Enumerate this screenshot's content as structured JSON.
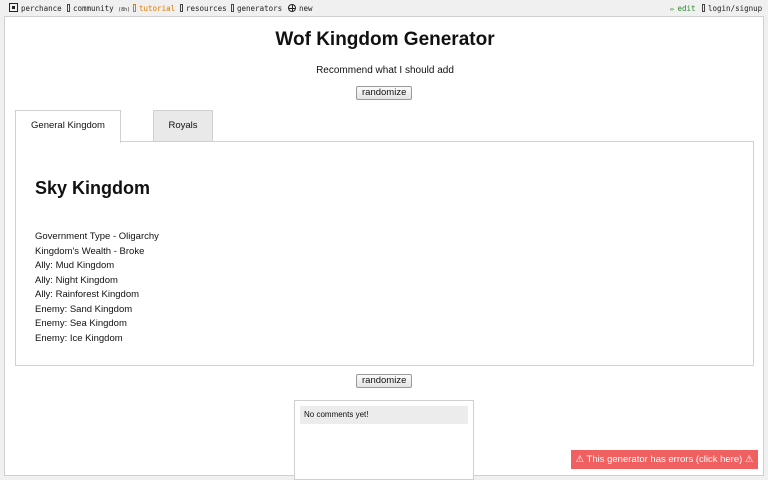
{
  "topbar": {
    "left": [
      {
        "key": "perchance",
        "label": "perchance",
        "icon": "perchance-logo-icon"
      },
      {
        "key": "community",
        "label": "community",
        "badge": "(8h)",
        "icon": "chat-icon"
      },
      {
        "key": "tutorial",
        "label": "tutorial",
        "icon": "book-icon"
      },
      {
        "key": "resources",
        "label": "resources",
        "icon": "resources-icon"
      },
      {
        "key": "generators",
        "label": "generators",
        "icon": "generators-icon"
      },
      {
        "key": "new",
        "label": "new",
        "icon": "plus-circle-icon"
      }
    ],
    "right": [
      {
        "key": "edit",
        "label": "edit",
        "icon": "pencil-icon"
      },
      {
        "key": "login",
        "label": "login/signup",
        "icon": "user-icon"
      }
    ]
  },
  "generator": {
    "title": "Wof Kingdom Generator",
    "subtitle": "Recommend what I should add",
    "randomize_label": "randomize"
  },
  "tabs": [
    {
      "label": "General Kingdom",
      "active": true
    },
    {
      "label": "Royals",
      "active": false
    }
  ],
  "result": {
    "kingdom_name": "Sky Kingdom",
    "lines": [
      "Government Type - Oligarchy",
      "Kingdom's Wealth - Broke",
      "Ally: Mud Kingdom",
      "Ally: Night Kingdom",
      "Ally: Rainforest Kingdom",
      "Enemy: Sand Kingdom",
      "Enemy: Sea Kingdom",
      "Enemy: Ice Kingdom"
    ]
  },
  "comments": {
    "empty_text": "No comments yet!"
  },
  "error_banner": {
    "text": "⚠ This generator has errors (click here) ⚠"
  },
  "colors": {
    "tutorial": "#e07b00",
    "edit": "#2a8a2a",
    "error_bg": "#f06060"
  }
}
